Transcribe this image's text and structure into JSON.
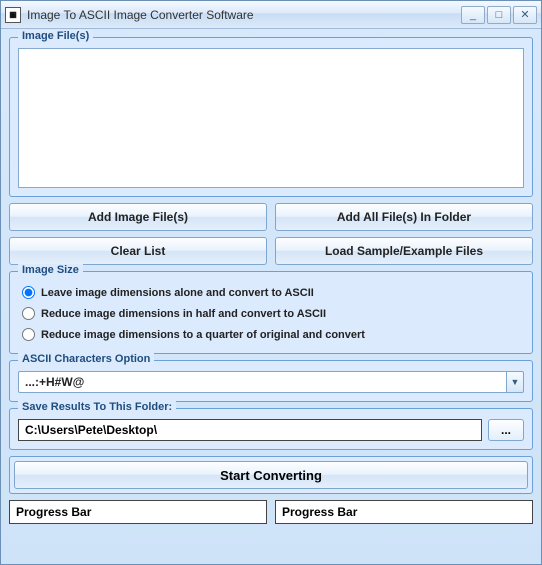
{
  "window": {
    "title": "Image To ASCII Image Converter Software"
  },
  "file_list": {
    "legend": "Image File(s)",
    "items": []
  },
  "buttons": {
    "add_files": "Add Image File(s)",
    "add_folder": "Add All File(s) In Folder",
    "clear_list": "Clear List",
    "load_sample": "Load Sample/Example Files",
    "browse": "...",
    "start": "Start Converting"
  },
  "image_size": {
    "legend": "Image Size",
    "selected": 0,
    "options": [
      "Leave image dimensions alone and convert to ASCII",
      "Reduce image dimensions in half and convert to ASCII",
      "Reduce image dimensions to a quarter of original and convert"
    ]
  },
  "ascii_option": {
    "legend": "ASCII Characters Option",
    "value": "...:+H#W@"
  },
  "save_folder": {
    "legend": "Save Results To This Folder:",
    "path": "C:\\Users\\Pete\\Desktop\\"
  },
  "progress": {
    "left": "Progress Bar",
    "right": "Progress Bar"
  }
}
